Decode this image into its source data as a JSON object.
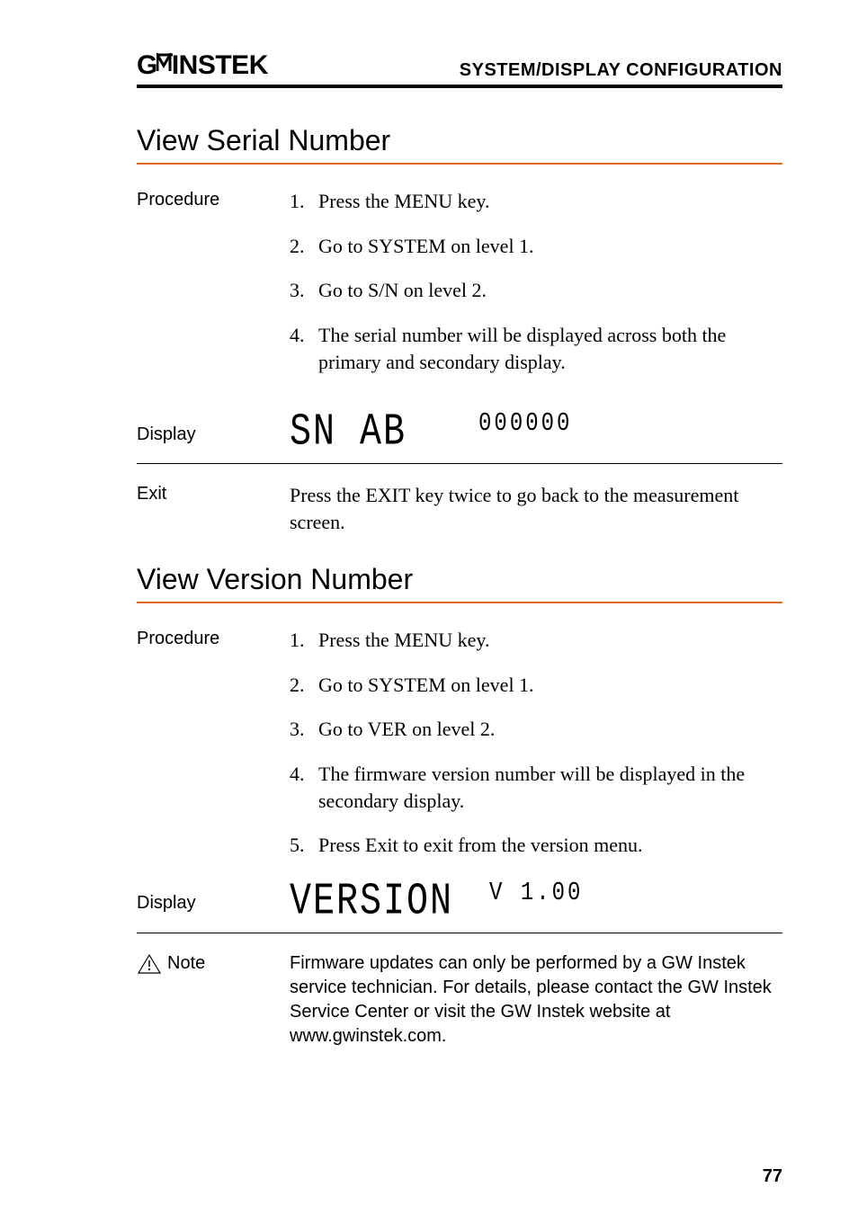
{
  "header": {
    "logo_text": "GWINSTEK",
    "title": "SYSTEM/DISPLAY CONFIGURATION"
  },
  "section1": {
    "heading": "View Serial Number",
    "procedure_label": "Procedure",
    "steps": [
      "Press the MENU key.",
      "Go to SYSTEM on level 1.",
      "Go to S/N on level 2.",
      "The serial number will be displayed across both the primary and secondary display."
    ],
    "display_label": "Display",
    "display_primary": "SN  AB",
    "display_secondary": "000000",
    "exit_label": "Exit",
    "exit_text": "Press the EXIT key twice to go back to the measurement screen."
  },
  "section2": {
    "heading": "View Version Number",
    "procedure_label": "Procedure",
    "steps": [
      "Press the MENU key.",
      "Go to SYSTEM on level 1.",
      "Go to VER on level 2.",
      "The firmware version number will be displayed in the secondary display.",
      "Press Exit to exit from the version menu."
    ],
    "display_label": "Display",
    "display_primary": "VERSION",
    "display_secondary": "V 1.00",
    "note_label": "Note",
    "note_text": "Firmware updates can only be performed by a GW Instek service technician. For details, please contact the GW Instek Service Center or visit the GW Instek website at www.gwinstek.com."
  },
  "page_number": "77"
}
